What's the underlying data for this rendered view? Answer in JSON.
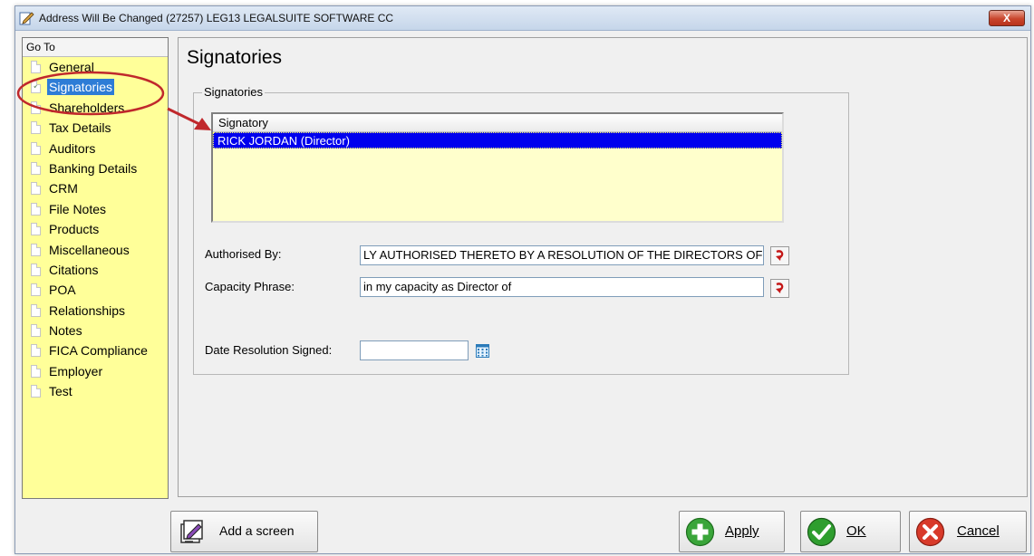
{
  "window": {
    "title": "Address Will Be Changed (27257) LEG13 LEGALSUITE SOFTWARE CC",
    "close_label": "X"
  },
  "goto": {
    "header": "Go To",
    "items": [
      {
        "label": "General"
      },
      {
        "label": "Signatories",
        "selected": true
      },
      {
        "label": "Shareholders"
      },
      {
        "label": "Tax Details"
      },
      {
        "label": "Auditors"
      },
      {
        "label": "Banking Details"
      },
      {
        "label": "CRM"
      },
      {
        "label": "File Notes"
      },
      {
        "label": "Products"
      },
      {
        "label": "Miscellaneous"
      },
      {
        "label": "Citations"
      },
      {
        "label": "POA"
      },
      {
        "label": "Relationships"
      },
      {
        "label": "Notes"
      },
      {
        "label": "FICA Compliance"
      },
      {
        "label": "Employer"
      },
      {
        "label": "Test"
      }
    ]
  },
  "content": {
    "title": "Signatories",
    "group_label": "Signatories",
    "list": {
      "column_header": "Signatory",
      "rows": [
        "RICK JORDAN (Director)"
      ]
    },
    "fields": {
      "authorised_by": {
        "label": "Authorised By:",
        "value": "LY AUTHORISED THERETO BY A RESOLUTION OF THE DIRECTORS OF"
      },
      "capacity_phrase": {
        "label": "Capacity Phrase:",
        "value": "in my capacity as Director of"
      },
      "date_resolution": {
        "label": "Date Resolution Signed:",
        "value": ""
      }
    }
  },
  "footer": {
    "add_screen_label": "Add a screen",
    "apply_label": "Apply",
    "ok_label": "OK",
    "cancel_label": "Cancel"
  },
  "colors": {
    "goto_background": "#ffff99",
    "list_background": "#ffffcc",
    "list_selection": "#0000ee",
    "nav_selection": "#2d7cd6",
    "annotation_red": "#c0282c"
  }
}
